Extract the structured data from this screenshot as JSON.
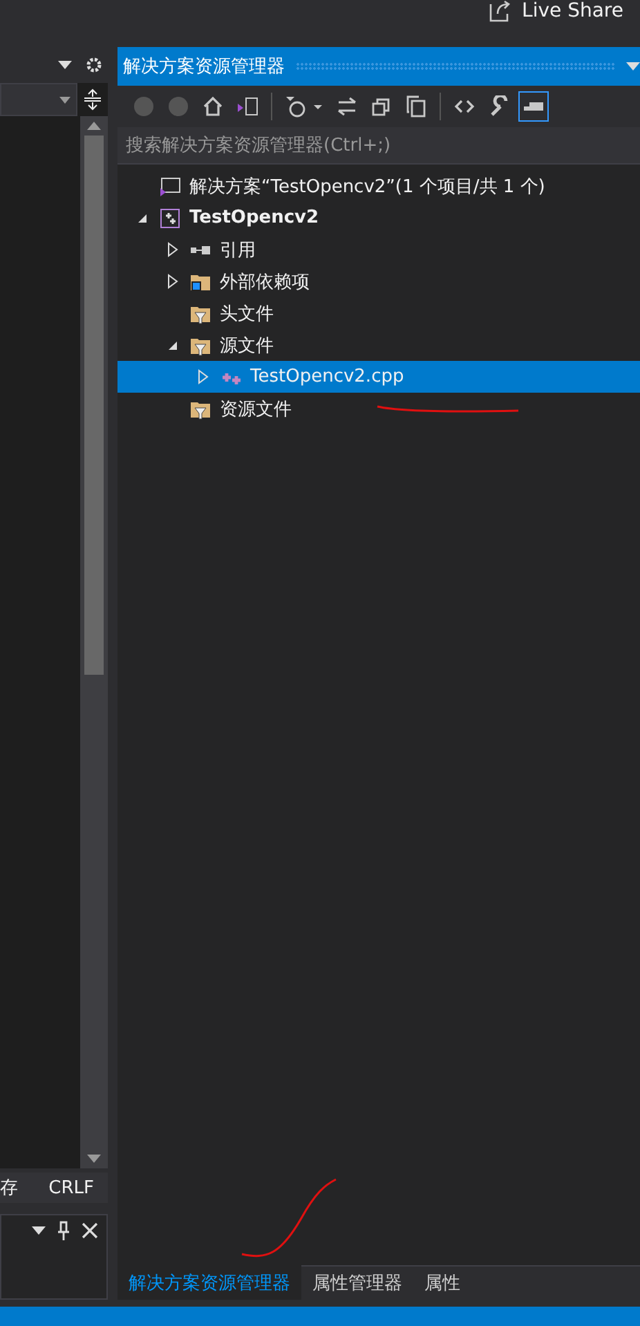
{
  "top_bar": {
    "live_share": "Live Share"
  },
  "left_pane": {
    "status_items": [
      "存",
      "CRLF"
    ]
  },
  "explorer": {
    "title": "解决方案资源管理器",
    "toolbar": [
      {
        "kind": "back",
        "disabled": true
      },
      {
        "kind": "forward",
        "disabled": true
      },
      {
        "kind": "home",
        "disabled": false
      },
      {
        "kind": "switch",
        "disabled": false
      },
      {
        "kind": "sep"
      },
      {
        "kind": "history",
        "disabled": false
      },
      {
        "kind": "sync",
        "disabled": false
      },
      {
        "kind": "collapse",
        "disabled": false
      },
      {
        "kind": "copy",
        "disabled": false
      },
      {
        "kind": "sep"
      },
      {
        "kind": "code",
        "disabled": false
      },
      {
        "kind": "wrench",
        "disabled": false
      },
      {
        "kind": "preview",
        "disabled": false,
        "selected": true
      }
    ],
    "search": {
      "placeholder": "搜索解决方案资源管理器(Ctrl+;)"
    },
    "tree": [
      {
        "label": "解决方案“TestOpencv2”(1 个项目/共 1 个)",
        "kind": "solution",
        "bold": false,
        "selected": false,
        "children": [
          {
            "label": "TestOpencv2",
            "kind": "project",
            "bold": true,
            "selected": false,
            "expanded": true,
            "children": [
              {
                "label": "引用",
                "kind": "references",
                "bold": false,
                "selected": false,
                "expanded": false
              },
              {
                "label": "外部依赖项",
                "kind": "external",
                "bold": false,
                "selected": false,
                "expanded": false
              },
              {
                "label": "头文件",
                "kind": "filter",
                "bold": false,
                "selected": false
              },
              {
                "label": "源文件",
                "kind": "filter",
                "bold": false,
                "selected": false,
                "expanded": true,
                "children": [
                  {
                    "label": "TestOpencv2.cpp",
                    "kind": "cpp",
                    "bold": false,
                    "selected": true,
                    "expanded": false
                  }
                ]
              },
              {
                "label": "资源文件",
                "kind": "filter",
                "bold": false,
                "selected": false
              }
            ]
          }
        ]
      }
    ],
    "tabs": [
      {
        "label": "解决方案资源管理器",
        "selected": true
      },
      {
        "label": "属性管理器",
        "selected": false
      },
      {
        "label": "属性",
        "selected": false
      }
    ]
  }
}
